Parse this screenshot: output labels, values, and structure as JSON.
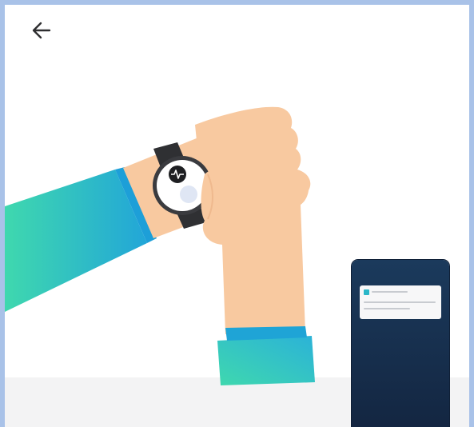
{
  "header": {
    "back_icon": "arrow-left-icon"
  },
  "illustration": {
    "watch_icon": "heart-rate-icon",
    "notification_icon": "app-icon"
  },
  "colors": {
    "sleeve_start": "#3fd6b0",
    "sleeve_end": "#24a6d6",
    "skin": "#f8c9a0",
    "watch_case": "#2f3033",
    "phone_bg": "#15304f",
    "floor": "#f3f3f4",
    "frame": "#a9c2e8"
  }
}
